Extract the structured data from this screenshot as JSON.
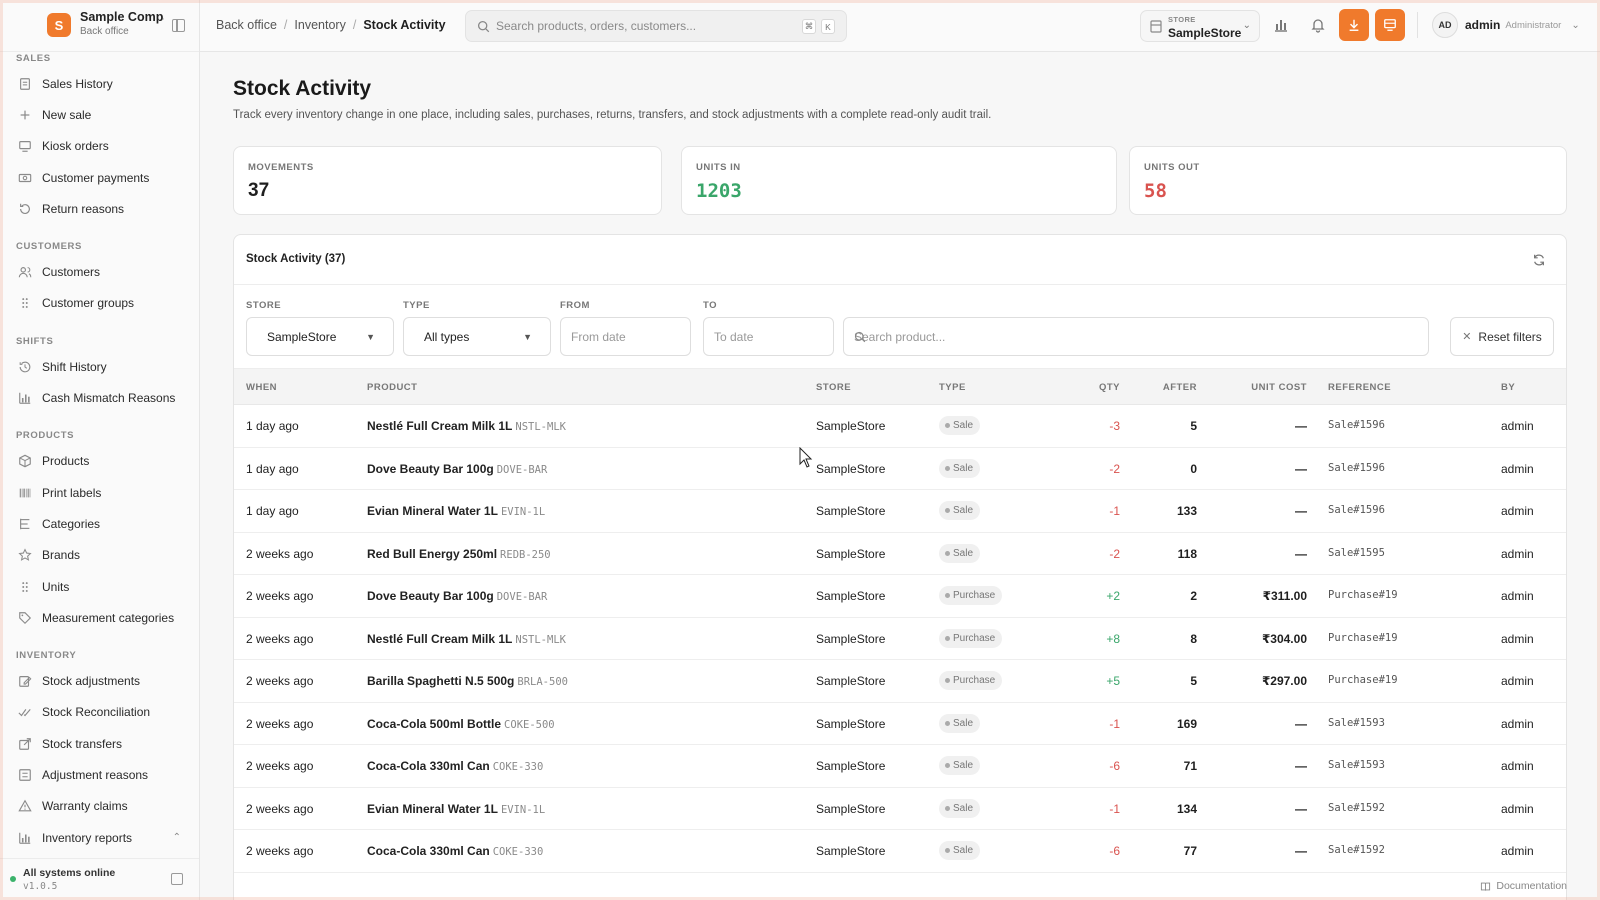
{
  "brand": {
    "logo_letter": "S",
    "name": "Sample Company",
    "sub": "Back office"
  },
  "sidebar": {
    "sections": [
      {
        "title": "SALES",
        "items": [
          {
            "label": "Sales History",
            "icon": "receipt-icon"
          },
          {
            "label": "New sale",
            "icon": "plus-icon"
          },
          {
            "label": "Kiosk orders",
            "icon": "monitor-icon"
          },
          {
            "label": "Customer payments",
            "icon": "cash-icon"
          },
          {
            "label": "Return reasons",
            "icon": "undo-icon"
          }
        ]
      },
      {
        "title": "CUSTOMERS",
        "items": [
          {
            "label": "Customers",
            "icon": "users-icon"
          },
          {
            "label": "Customer groups",
            "icon": "grip-icon"
          }
        ]
      },
      {
        "title": "SHIFTS",
        "items": [
          {
            "label": "Shift History",
            "icon": "clock-icon"
          },
          {
            "label": "Cash Mismatch Reasons",
            "icon": "bar-chart-icon"
          }
        ]
      },
      {
        "title": "PRODUCTS",
        "items": [
          {
            "label": "Products",
            "icon": "box-icon"
          },
          {
            "label": "Print labels",
            "icon": "barcode-icon"
          },
          {
            "label": "Categories",
            "icon": "tree-icon"
          },
          {
            "label": "Brands",
            "icon": "star-icon"
          },
          {
            "label": "Units",
            "icon": "grip-icon"
          },
          {
            "label": "Measurement categories",
            "icon": "tag-icon"
          }
        ]
      },
      {
        "title": "INVENTORY",
        "items": [
          {
            "label": "Stock adjustments",
            "icon": "edit-icon"
          },
          {
            "label": "Stock Reconciliation",
            "icon": "check-check-icon"
          },
          {
            "label": "Stock transfers",
            "icon": "external-link-icon"
          },
          {
            "label": "Adjustment reasons",
            "icon": "list-icon"
          },
          {
            "label": "Warranty claims",
            "icon": "warning-icon"
          },
          {
            "label": "Inventory reports",
            "icon": "bar-chart-icon"
          }
        ]
      }
    ],
    "footer": {
      "status": "All systems online",
      "version": "v1.0.5"
    }
  },
  "topbar": {
    "breadcrumb": [
      "Back office",
      "Inventory",
      "Stock Activity"
    ],
    "search_placeholder": "Search products, orders, customers...",
    "kbd": [
      "⌘",
      "K"
    ],
    "store_label": "STORE",
    "store_value": "SampleStore",
    "user": {
      "initials": "AD",
      "name": "admin",
      "role": "Administrator"
    }
  },
  "page": {
    "title": "Stock Activity",
    "description": "Track every inventory change in one place, including sales, purchases, returns, transfers, and stock adjustments with a complete read-only audit trail."
  },
  "stats": [
    {
      "label": "MOVEMENTS",
      "value": "37",
      "color": "#1f1f1f"
    },
    {
      "label": "UNITS IN",
      "value": "1203",
      "color": "#3aa66a"
    },
    {
      "label": "UNITS OUT",
      "value": "58",
      "color": "#d9534f"
    }
  ],
  "panel": {
    "title": "Stock Activity (37)",
    "filters": {
      "store_label": "STORE",
      "store_value": "SampleStore",
      "type_label": "TYPE",
      "type_value": "All types",
      "from_label": "FROM",
      "from_placeholder": "From date",
      "to_label": "TO",
      "to_placeholder": "To date",
      "search_placeholder": "Search product...",
      "reset_label": "Reset filters"
    },
    "columns": [
      "WHEN",
      "PRODUCT",
      "STORE",
      "TYPE",
      "QTY",
      "AFTER",
      "UNIT COST",
      "REFERENCE",
      "BY"
    ],
    "rows": [
      {
        "when": "1 day ago",
        "product": "Nestlé Full Cream Milk 1L",
        "sku": "NSTL-MLK",
        "store": "SampleStore",
        "type": "Sale",
        "qty": "-3",
        "after": "5",
        "cost": "—",
        "ref": "Sale#1596",
        "by": "admin"
      },
      {
        "when": "1 day ago",
        "product": "Dove Beauty Bar 100g",
        "sku": "DOVE-BAR",
        "store": "SampleStore",
        "type": "Sale",
        "qty": "-2",
        "after": "0",
        "cost": "—",
        "ref": "Sale#1596",
        "by": "admin"
      },
      {
        "when": "1 day ago",
        "product": "Evian Mineral Water 1L",
        "sku": "EVIN-1L",
        "store": "SampleStore",
        "type": "Sale",
        "qty": "-1",
        "after": "133",
        "cost": "—",
        "ref": "Sale#1596",
        "by": "admin"
      },
      {
        "when": "2 weeks ago",
        "product": "Red Bull Energy 250ml",
        "sku": "REDB-250",
        "store": "SampleStore",
        "type": "Sale",
        "qty": "-2",
        "after": "118",
        "cost": "—",
        "ref": "Sale#1595",
        "by": "admin"
      },
      {
        "when": "2 weeks ago",
        "product": "Dove Beauty Bar 100g",
        "sku": "DOVE-BAR",
        "store": "SampleStore",
        "type": "Purchase",
        "qty": "+2",
        "after": "2",
        "cost": "₹311.00",
        "ref": "Purchase#19",
        "by": "admin"
      },
      {
        "when": "2 weeks ago",
        "product": "Nestlé Full Cream Milk 1L",
        "sku": "NSTL-MLK",
        "store": "SampleStore",
        "type": "Purchase",
        "qty": "+8",
        "after": "8",
        "cost": "₹304.00",
        "ref": "Purchase#19",
        "by": "admin"
      },
      {
        "when": "2 weeks ago",
        "product": "Barilla Spaghetti N.5 500g",
        "sku": "BRLA-500",
        "store": "SampleStore",
        "type": "Purchase",
        "qty": "+5",
        "after": "5",
        "cost": "₹297.00",
        "ref": "Purchase#19",
        "by": "admin"
      },
      {
        "when": "2 weeks ago",
        "product": "Coca-Cola 500ml Bottle",
        "sku": "COKE-500",
        "store": "SampleStore",
        "type": "Sale",
        "qty": "-1",
        "after": "169",
        "cost": "—",
        "ref": "Sale#1593",
        "by": "admin"
      },
      {
        "when": "2 weeks ago",
        "product": "Coca-Cola 330ml Can",
        "sku": "COKE-330",
        "store": "SampleStore",
        "type": "Sale",
        "qty": "-6",
        "after": "71",
        "cost": "—",
        "ref": "Sale#1593",
        "by": "admin"
      },
      {
        "when": "2 weeks ago",
        "product": "Evian Mineral Water 1L",
        "sku": "EVIN-1L",
        "store": "SampleStore",
        "type": "Sale",
        "qty": "-1",
        "after": "134",
        "cost": "—",
        "ref": "Sale#1592",
        "by": "admin"
      },
      {
        "when": "2 weeks ago",
        "product": "Coca-Cola 330ml Can",
        "sku": "COKE-330",
        "store": "SampleStore",
        "type": "Sale",
        "qty": "-6",
        "after": "77",
        "cost": "—",
        "ref": "Sale#1592",
        "by": "admin"
      }
    ]
  },
  "footer_link": "Documentation",
  "colors": {
    "accent": "#f07a2c",
    "positive": "#3aa66a",
    "negative": "#d9534f"
  }
}
